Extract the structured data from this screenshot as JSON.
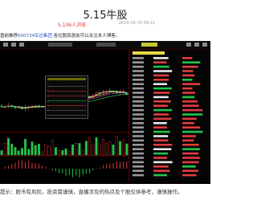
{
  "article": {
    "title": "5.15牛股",
    "views": "5,106人浏览",
    "date": "2019-05-15 09:21"
  },
  "ticker_line": {
    "prefix": "盘前推荐",
    "stock_code": "600734",
    "stock_name": "实达集团",
    "suffix": " 各位股民朋友可以关注本人博客。"
  },
  "notice": "提示：股市有风险，投资需谨慎，直播涉及的热点及个股仅供参考，谨慎操作。",
  "colors": {
    "up": "#e23b3b",
    "down": "#24c24a",
    "ma_white": "#e8e8e8",
    "ma_yellow": "#e8d84a",
    "ma_purple": "#c64ad8",
    "ma_green": "#3ad85a",
    "panel_bg": "#000000"
  }
}
